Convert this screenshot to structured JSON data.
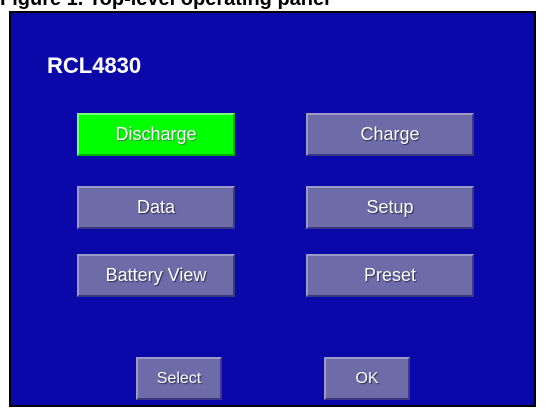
{
  "caption": "Figure 1. Top-level operating panel",
  "screen": {
    "model": "RCL4830"
  },
  "menu": {
    "discharge": "Discharge",
    "charge": "Charge",
    "data": "Data",
    "setup": "Setup",
    "battery_view": "Battery View",
    "preset": "Preset"
  },
  "footer": {
    "select": "Select",
    "ok": "OK"
  },
  "colors": {
    "screen_background": "#0a08a8",
    "button_background": "#6e6ca8",
    "selected_button": "#00ff00",
    "text": "#ffffff"
  },
  "selected_item": "Discharge"
}
